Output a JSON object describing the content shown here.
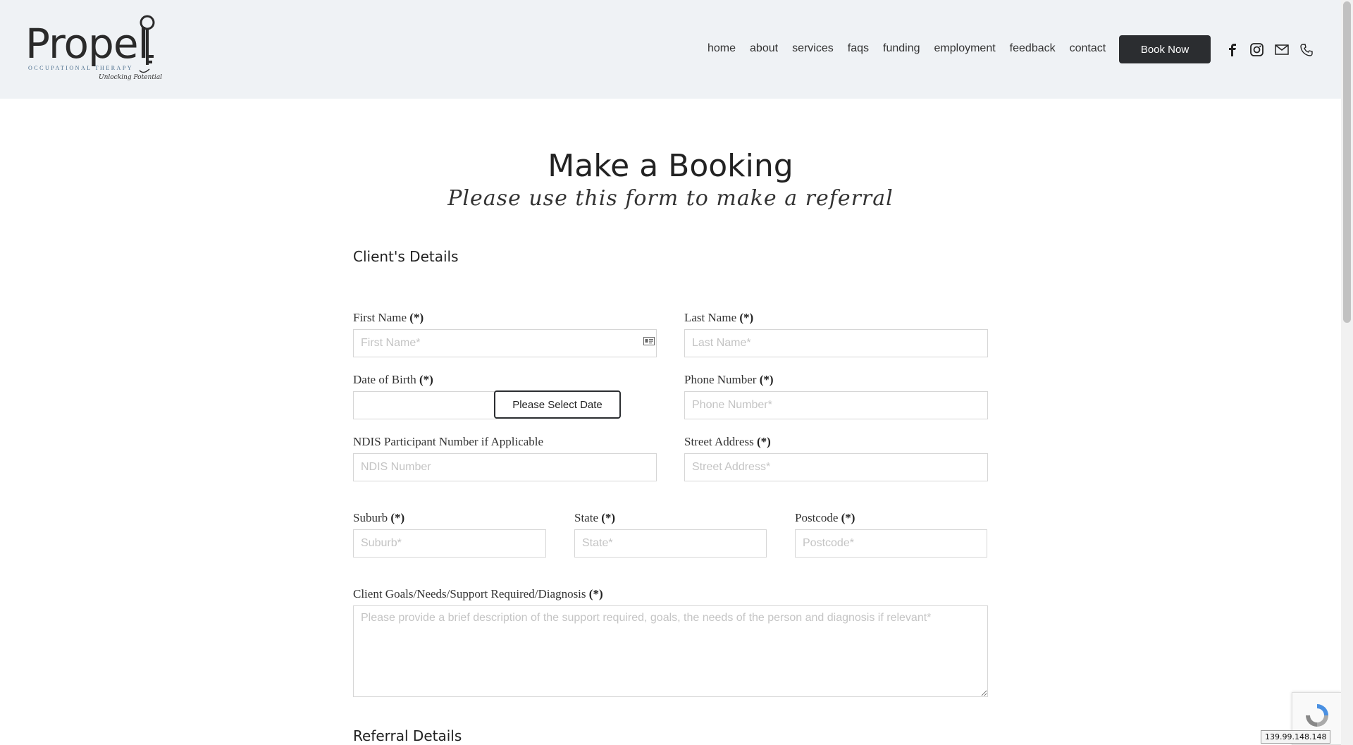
{
  "header": {
    "logo": {
      "word": "Propel",
      "subtitle": "OCCUPATIONAL THERAPY",
      "tagline": "Unlocking Potential"
    },
    "nav": [
      {
        "label": "home",
        "name": "nav-home"
      },
      {
        "label": "about",
        "name": "nav-about"
      },
      {
        "label": "services",
        "name": "nav-services"
      },
      {
        "label": "faqs",
        "name": "nav-faqs"
      },
      {
        "label": "funding",
        "name": "nav-funding"
      },
      {
        "label": "employment",
        "name": "nav-employment"
      },
      {
        "label": "feedback",
        "name": "nav-feedback"
      },
      {
        "label": "contact",
        "name": "nav-contact"
      }
    ],
    "book_button": "Book Now",
    "social_icons": [
      "facebook-icon",
      "instagram-icon",
      "email-icon",
      "phone-icon"
    ]
  },
  "page": {
    "title": "Make a Booking",
    "subtitle": "Please use this form to make a referral"
  },
  "form": {
    "section_client": "Client's Details",
    "required_marker": "(*)",
    "first_name": {
      "label": "First Name",
      "placeholder": "First Name*",
      "value": ""
    },
    "last_name": {
      "label": "Last Name",
      "placeholder": "Last Name*",
      "value": ""
    },
    "dob": {
      "label": "Date of Birth",
      "value": "",
      "button": "Please Select Date"
    },
    "phone": {
      "label": "Phone Number",
      "placeholder": "Phone Number*",
      "value": ""
    },
    "ndis": {
      "label": "NDIS Participant Number if Applicable",
      "placeholder": "NDIS Number",
      "value": ""
    },
    "street": {
      "label": "Street Address",
      "placeholder": "Street Address*",
      "value": ""
    },
    "suburb": {
      "label": "Suburb",
      "placeholder": "Suburb*",
      "value": ""
    },
    "state": {
      "label": "State",
      "placeholder": "State*",
      "value": ""
    },
    "postcode": {
      "label": "Postcode",
      "placeholder": "Postcode*",
      "value": ""
    },
    "goals": {
      "label": "Client Goals/Needs/Support Required/Diagnosis",
      "placeholder": "Please provide a brief description of the support required, goals, the needs of the person and diagnosis if relevant*",
      "value": ""
    },
    "section_referral": "Referral Details"
  },
  "footer_overlay": {
    "ip_address": "139.99.148.148"
  },
  "colors": {
    "header_bg": "#eff2f5",
    "button_dark": "#2b2d30",
    "logo_accent": "#4a6d8c"
  }
}
